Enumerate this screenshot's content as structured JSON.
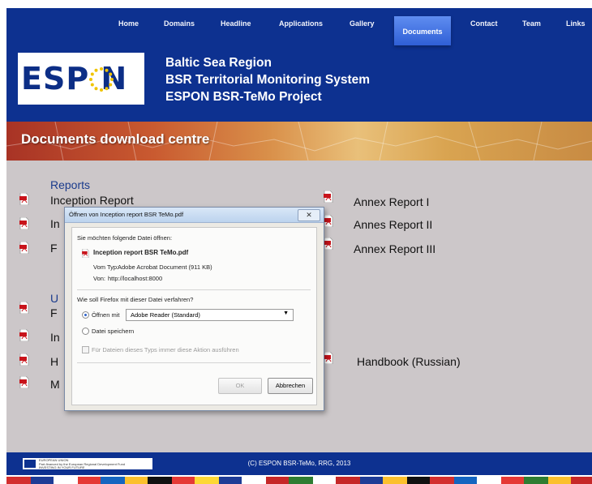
{
  "nav": [
    {
      "label": "Home"
    },
    {
      "label": "Domains"
    },
    {
      "label": "Headline"
    },
    {
      "label": "Applications"
    },
    {
      "label": "Gallery"
    },
    {
      "label": "Documents"
    },
    {
      "label": "Contact"
    },
    {
      "label": "Team"
    },
    {
      "label": "Links"
    }
  ],
  "logo_text": "ESP N",
  "header_lines": [
    "Baltic Sea Region",
    "BSR Territorial Monitoring System",
    "ESPON BSR-TeMo Project"
  ],
  "banner_title": "Documents download centre",
  "sections": {
    "reports_title": "Reports",
    "left_items": [
      "Inception Report",
      "In",
      "F"
    ],
    "right_items": [
      "Annex Report I",
      "Annes Report II",
      "Annex Report III"
    ],
    "second_title": "U",
    "second_left": [
      "F",
      "In",
      "H",
      "M"
    ],
    "second_right": [
      "Handbook (Russian)"
    ]
  },
  "dialog": {
    "title": "Öffnen von Inception report BSR TeMo.pdf",
    "close": "✕",
    "intro": "Sie möchten folgende Datei öffnen:",
    "filename": "Inception report BSR TeMo.pdf",
    "type_label": "Vom Typ:",
    "type_value": "Adobe Acrobat Document (911 KB)",
    "from_label": "Von:",
    "from_value": "http://localhost:8000",
    "question": "Wie soll Firefox mit dieser Datei verfahren?",
    "open_with": "Öffnen mit",
    "app_select": "Adobe Reader  (Standard)",
    "save_file": "Datei speichern",
    "always_text": "Für Dateien dieses Typs immer diese Aktion ausführen",
    "ok": "OK",
    "cancel": "Abbrechen"
  },
  "footer": {
    "eu_text": [
      "EUROPEAN UNION",
      "Part-financed by the European Regional Development Fund",
      "INVESTING IN YOUR FUTURE"
    ],
    "copyright": "(C) ESPON BSR-TeMo, RRG, 2013"
  },
  "colors": {
    "header": "#0d3190",
    "nav_active": "#3f6fe0",
    "content_bg": "#ccc7c9",
    "pdf_red": "#c8141b"
  }
}
